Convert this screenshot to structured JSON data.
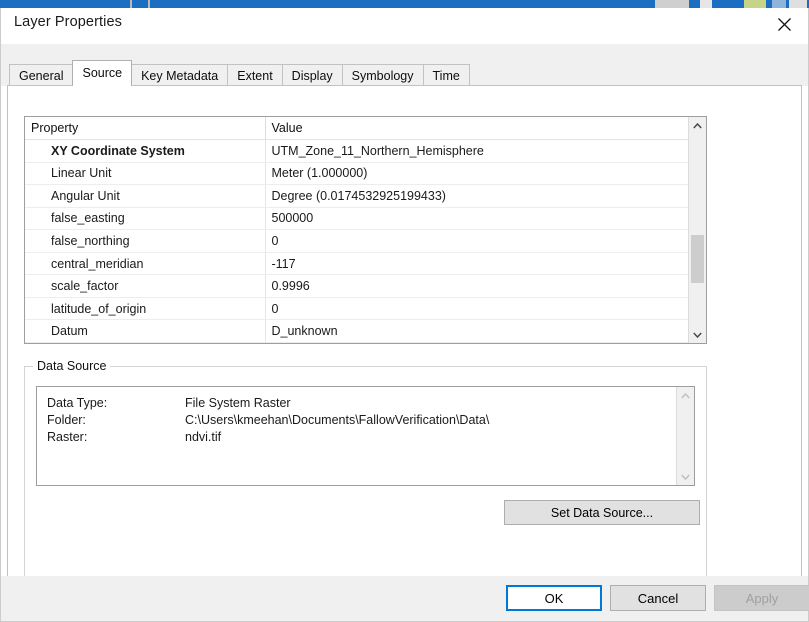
{
  "window": {
    "title": "Layer Properties",
    "close_icon": "close-icon"
  },
  "tabs": [
    {
      "label": "General",
      "active": false
    },
    {
      "label": "Source",
      "active": true
    },
    {
      "label": "Key Metadata",
      "active": false
    },
    {
      "label": "Extent",
      "active": false
    },
    {
      "label": "Display",
      "active": false
    },
    {
      "label": "Symbology",
      "active": false
    },
    {
      "label": "Time",
      "active": false
    }
  ],
  "properties_table": {
    "headers": [
      "Property",
      "Value"
    ],
    "rows": [
      {
        "property": "XY Coordinate System",
        "value": "UTM_Zone_11_Northern_Hemisphere",
        "bold": true
      },
      {
        "property": "Linear Unit",
        "value": "Meter (1.000000)",
        "bold": false
      },
      {
        "property": "Angular Unit",
        "value": "Degree (0.0174532925199433)",
        "bold": false
      },
      {
        "property": "false_easting",
        "value": "500000",
        "bold": false
      },
      {
        "property": "false_northing",
        "value": "0",
        "bold": false
      },
      {
        "property": "central_meridian",
        "value": "-117",
        "bold": false
      },
      {
        "property": "scale_factor",
        "value": "0.9996",
        "bold": false
      },
      {
        "property": "latitude_of_origin",
        "value": "0",
        "bold": false
      },
      {
        "property": "Datum",
        "value": "D_unknown",
        "bold": false
      }
    ],
    "scrollbar": {
      "up_icon": "chevron-up-icon",
      "down_icon": "chevron-down-icon"
    }
  },
  "data_source": {
    "legend": "Data Source",
    "fields": [
      {
        "label": "Data Type:",
        "value": "File System Raster"
      },
      {
        "label": "Folder:",
        "value": "C:\\Users\\kmeehan\\Documents\\FallowVerification\\Data\\"
      },
      {
        "label": "Raster:",
        "value": "ndvi.tif"
      }
    ],
    "scrollbar": {
      "up_icon": "chevron-up-icon",
      "down_icon": "chevron-down-icon"
    },
    "set_data_source_label": "Set Data Source..."
  },
  "footer": {
    "ok_label": "OK",
    "cancel_label": "Cancel",
    "apply_label": "Apply"
  },
  "colors": {
    "accent": "#0078d7",
    "dialog_bg": "#ffffff",
    "chrome_bg": "#f0f0f0",
    "button_face": "#e1e1e1",
    "disabled_text": "#a0a0a0"
  }
}
